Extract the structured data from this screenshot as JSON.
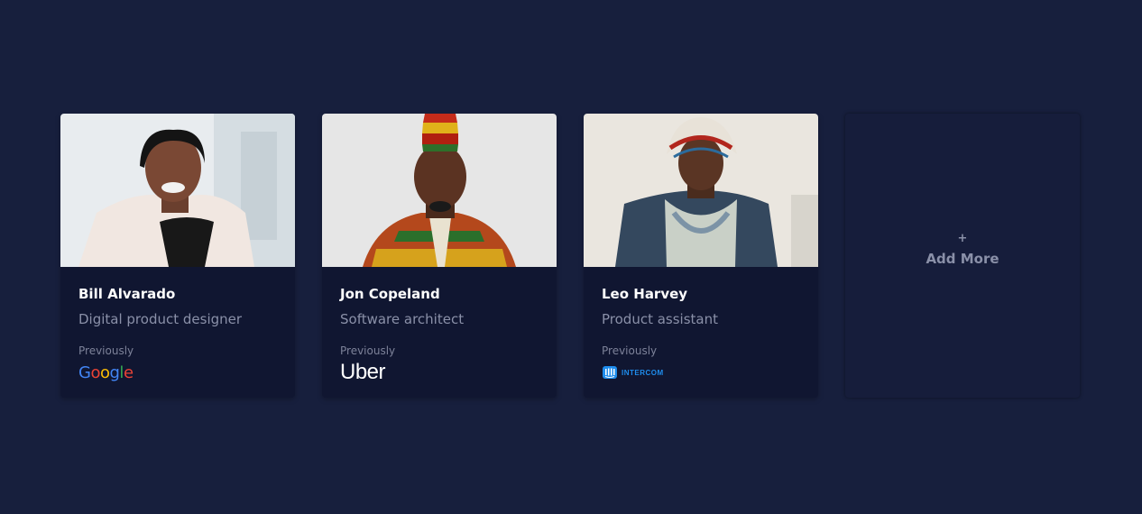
{
  "people": [
    {
      "name": "Bill Alvarado",
      "role": "Digital product designer",
      "previously_label": "Previously",
      "company": "Google",
      "logo_icon": "google-logo"
    },
    {
      "name": "Jon Copeland",
      "role": "Software architect",
      "previously_label": "Previously",
      "company": "Uber",
      "logo_icon": "uber-logo"
    },
    {
      "name": "Leo Harvey",
      "role": "Product assistant",
      "previously_label": "Previously",
      "company": "INTERCOM",
      "logo_icon": "intercom-logo"
    }
  ],
  "add_card": {
    "icon": "+",
    "label": "Add More"
  },
  "colors": {
    "background": "#171f3d",
    "card": "#101631",
    "name_text": "#ffffff",
    "muted_text": "#8a90a8",
    "intercom_blue": "#1f8ded",
    "google_blue": "#4285f4",
    "google_red": "#ea4335",
    "google_yellow": "#fbbc05",
    "google_green": "#34a853"
  }
}
